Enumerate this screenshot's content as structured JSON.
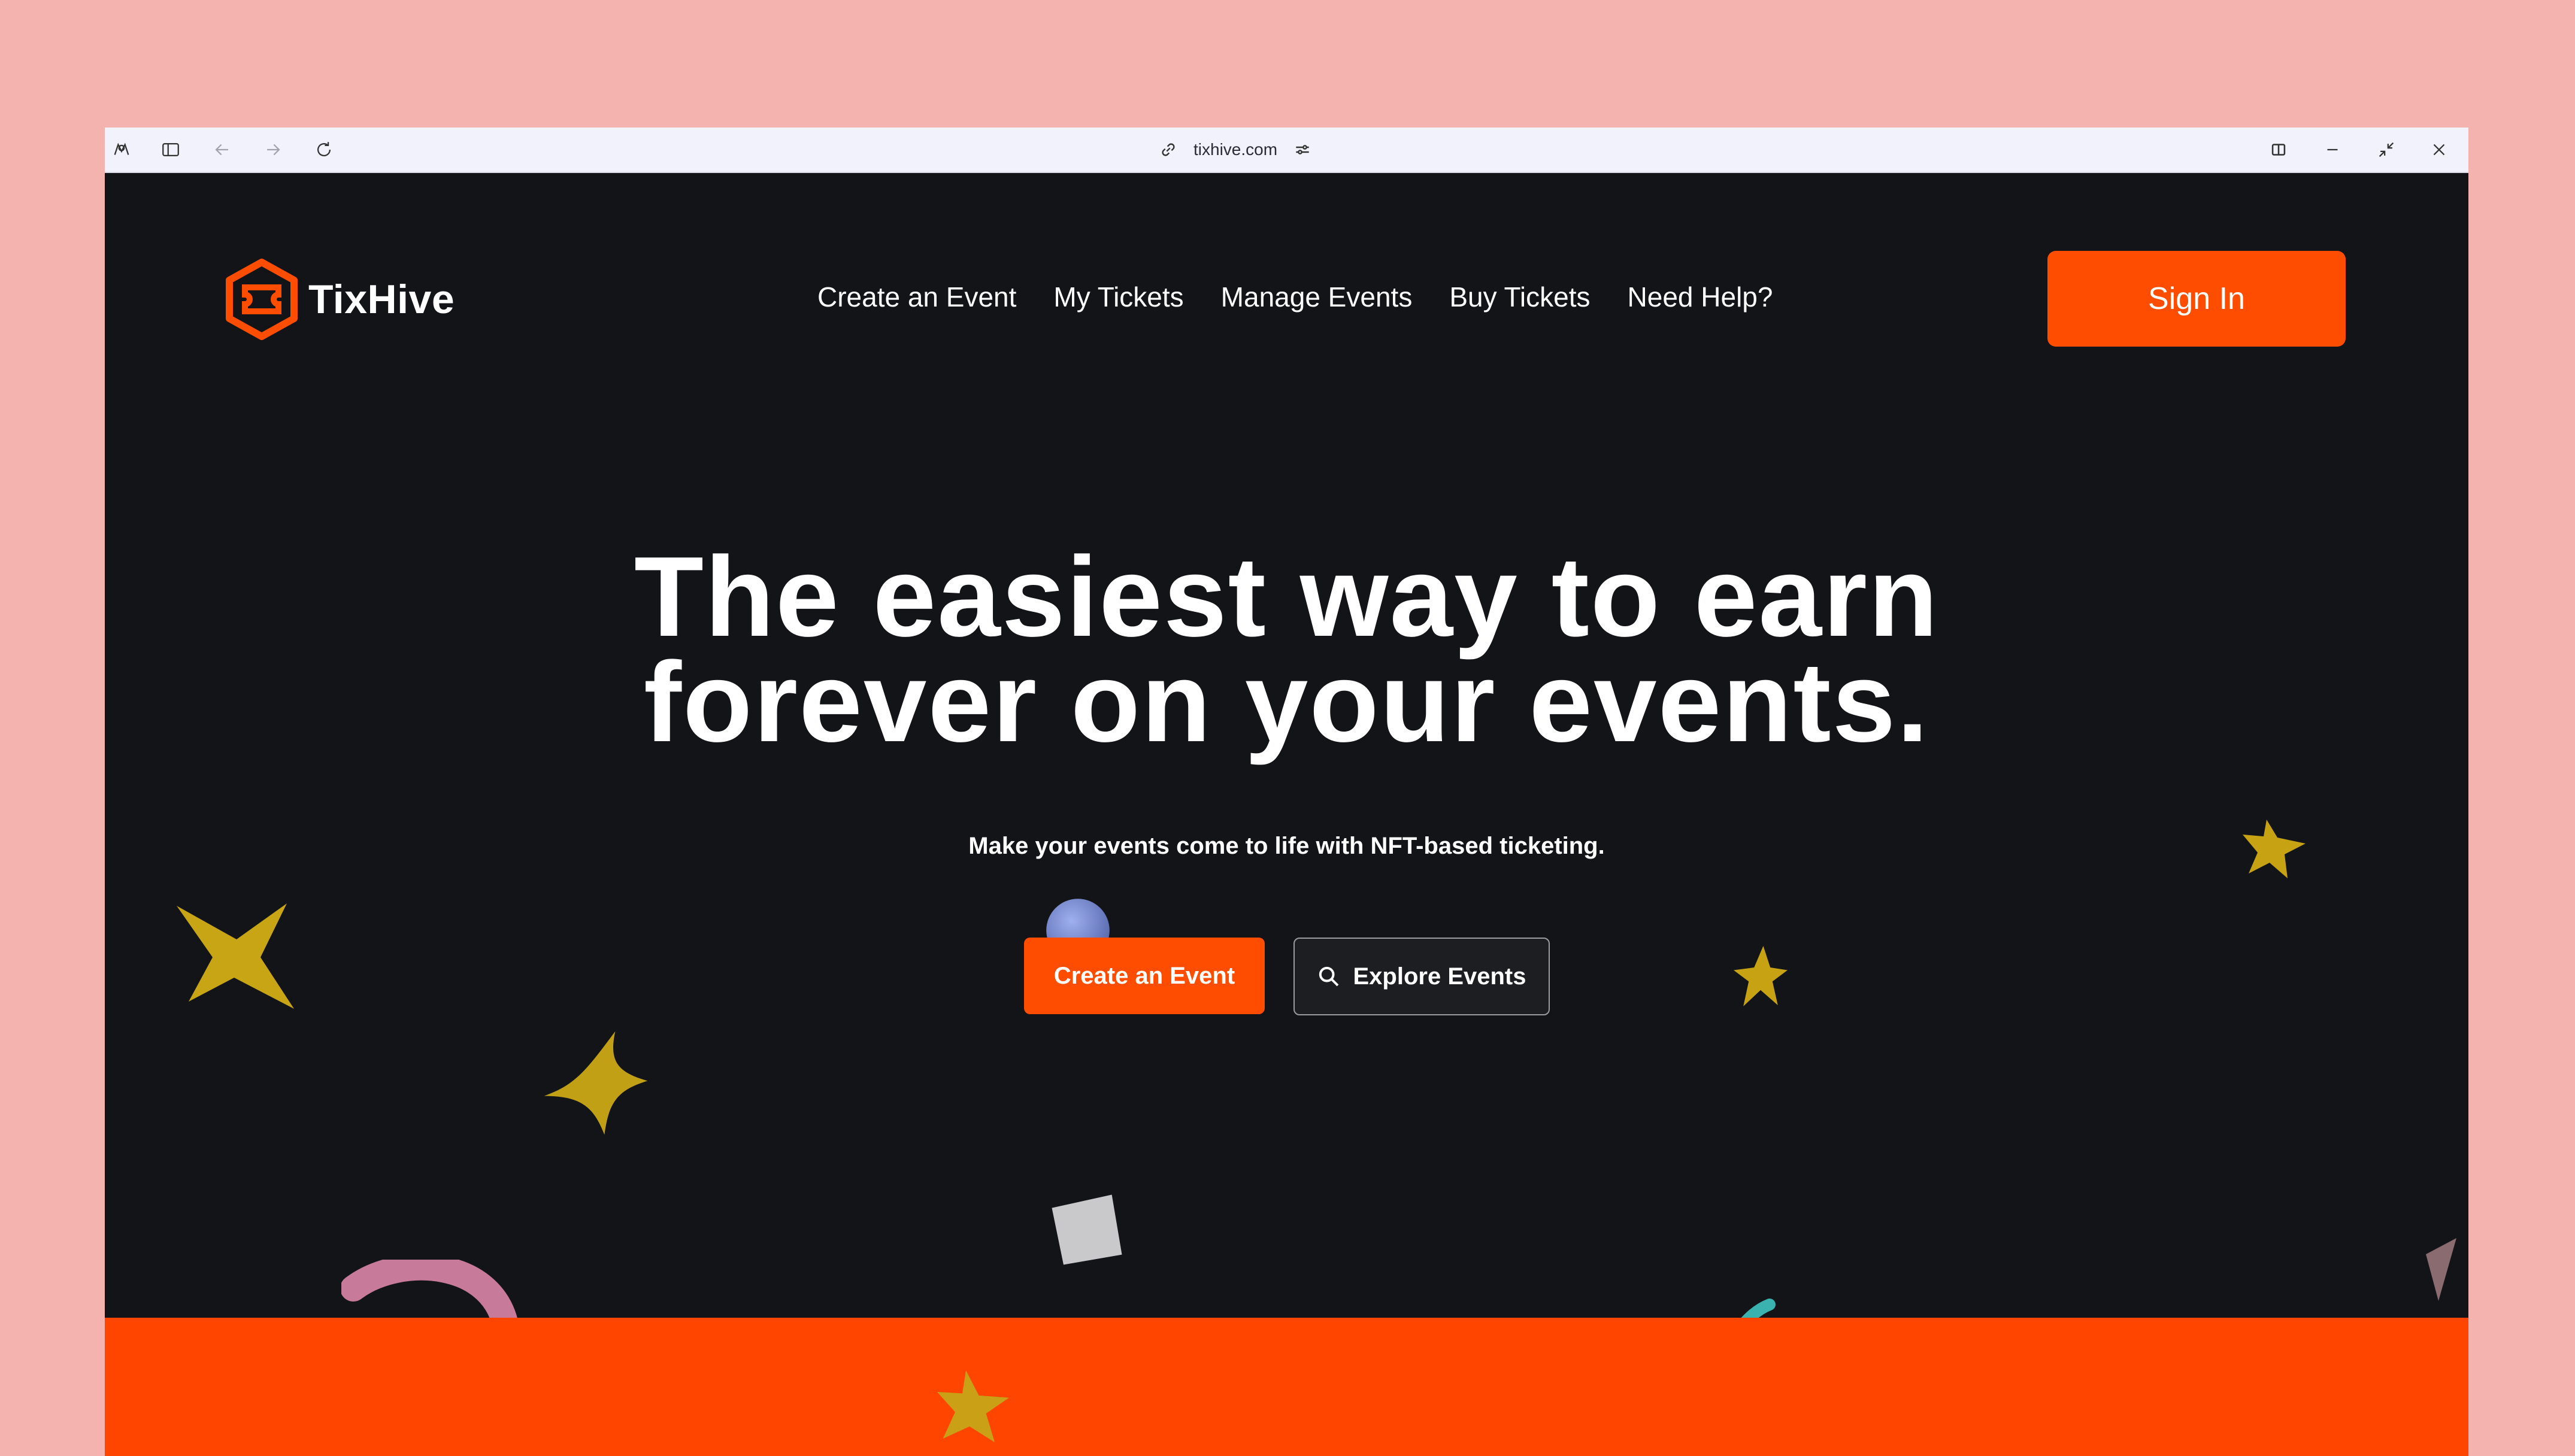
{
  "browser": {
    "url": "tixhive.com",
    "icons": [
      "app-icon",
      "sidebar-toggle-icon",
      "back-icon",
      "forward-icon",
      "reload-icon",
      "link-icon",
      "site-settings-icon",
      "split-view-icon",
      "minimize-icon",
      "restore-icon",
      "close-icon"
    ]
  },
  "nav": {
    "brand": "TixHive",
    "links": [
      "Create an Event",
      "My Tickets",
      "Manage Events",
      "Buy Tickets",
      "Need Help?"
    ],
    "signin": "Sign In"
  },
  "hero": {
    "title_line1": "The easiest way to earn",
    "title_line2": "forever on your events.",
    "subtitle": "Make your events come to life with NFT-based ticketing.",
    "primary_cta": "Create an Event",
    "secondary_cta": "Explore Events"
  },
  "colors": {
    "accent": "#ff4d00",
    "background": "#131418",
    "outer": "#f5b3b0"
  }
}
